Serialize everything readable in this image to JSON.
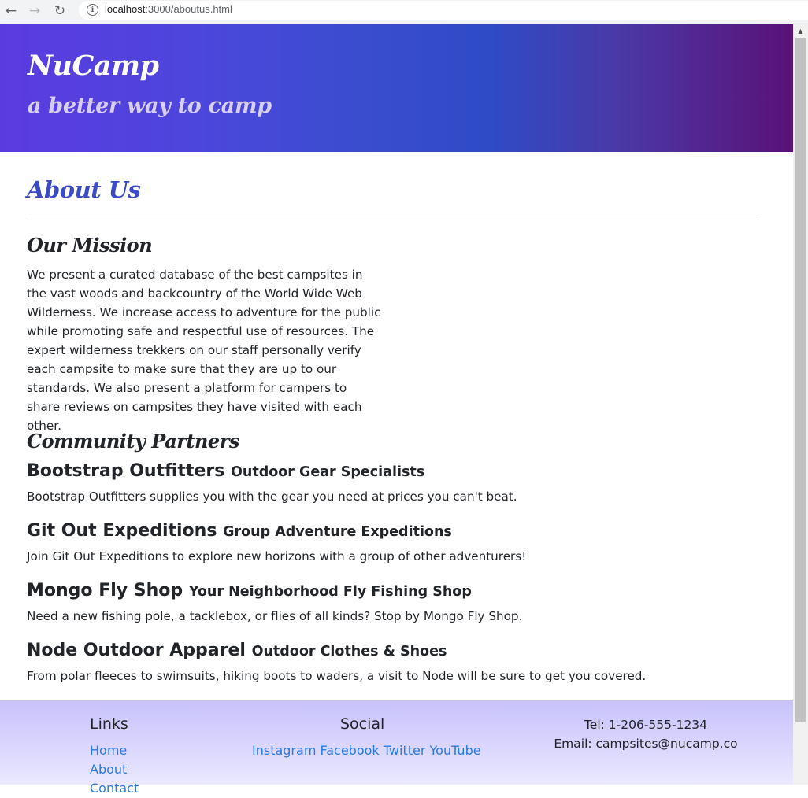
{
  "browser": {
    "url_host": "localhost",
    "url_path": ":3000/aboutus.html",
    "back_icon": "arrow-left-icon",
    "forward_icon": "arrow-right-icon",
    "reload_icon": "reload-icon",
    "info_icon": "info-icon"
  },
  "header": {
    "brand": "NuCamp",
    "tagline": "a better way to camp"
  },
  "main": {
    "page_title": "About Us",
    "mission": {
      "title": "Our Mission",
      "text": "We present a curated database of the best campsites in the vast woods and backcountry of the World Wide Web Wilderness. We increase access to adventure for the public while promoting safe and respectful use of resources. The expert wilderness trekkers on our staff personally verify each campsite to make sure that they are up to our standards. We also present a platform for campers to share reviews on campsites they have visited with each other."
    },
    "partners": {
      "title": "Community Partners",
      "items": [
        {
          "name": "Bootstrap Outfitters",
          "tagline": "Outdoor Gear Specialists",
          "description": "Bootstrap Outfitters supplies you with the gear you need at prices you can't beat."
        },
        {
          "name": "Git Out Expeditions",
          "tagline": "Group Adventure Expeditions",
          "description": "Join Git Out Expeditions to explore new horizons with a group of other adventurers!"
        },
        {
          "name": "Mongo Fly Shop",
          "tagline": "Your Neighborhood Fly Fishing Shop",
          "description": "Need a new fishing pole, a tacklebox, or flies of all kinds? Stop by Mongo Fly Shop."
        },
        {
          "name": "Node Outdoor Apparel",
          "tagline": "Outdoor Clothes & Shoes",
          "description": "From polar fleeces to swimsuits, hiking boots to waders, a visit to Node will be sure to get you covered."
        }
      ]
    }
  },
  "footer": {
    "links_title": "Links",
    "links": [
      "Home",
      "About",
      "Contact"
    ],
    "social_title": "Social",
    "social": [
      "Instagram",
      "Facebook",
      "Twitter",
      "YouTube"
    ],
    "tel": "Tel: 1-206-555-1234",
    "email": "Email: campsites@nucamp.co"
  },
  "colors": {
    "accent": "#3b4bc8",
    "link": "#2a7ae2",
    "jumbotron_start": "#5b3be0",
    "jumbotron_end": "#5a1178",
    "footer_bg": "#c8c2fb"
  }
}
